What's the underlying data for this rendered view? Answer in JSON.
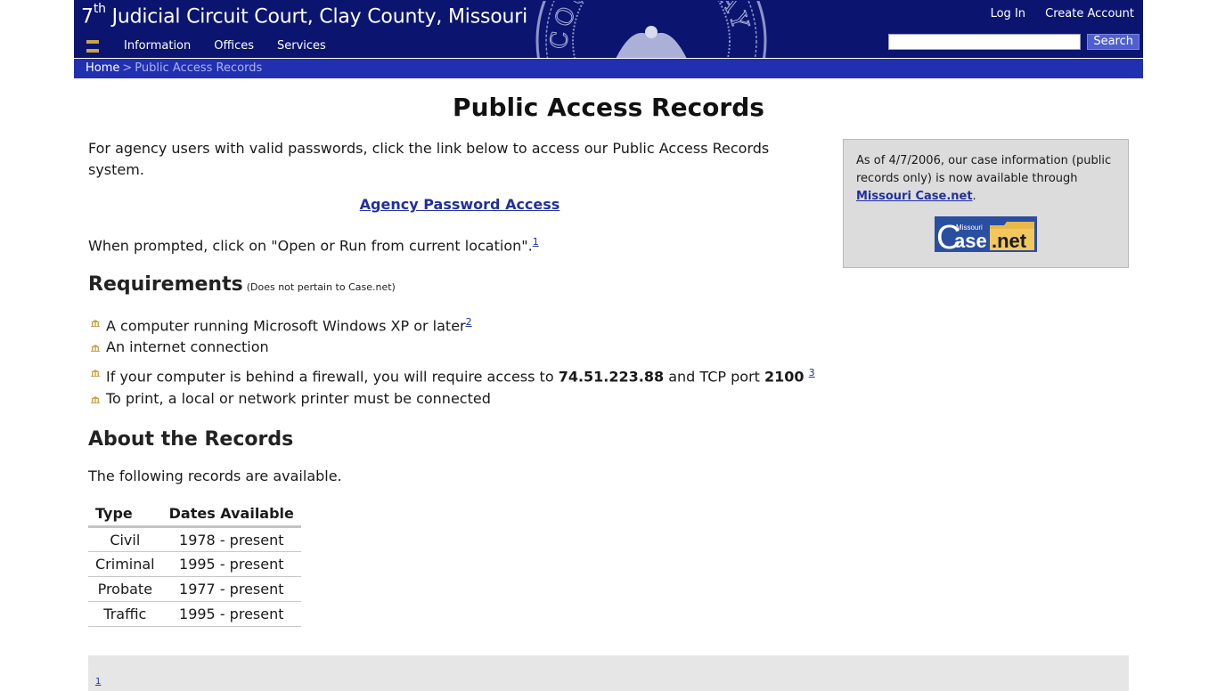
{
  "header": {
    "title_sup": "th",
    "title_prefix": "7",
    "title_rest": " Judicial Circuit Court,  Clay County, Missouri",
    "nav": [
      {
        "label": "Information"
      },
      {
        "label": "Offices"
      },
      {
        "label": "Services"
      }
    ],
    "account": {
      "login_label": "Log In",
      "create_label": "Create Account"
    },
    "search": {
      "value": "",
      "placeholder": "",
      "button_label": "Search"
    },
    "seal_text": "COURT OF CLAY"
  },
  "breadcrumb": {
    "home": "Home",
    "separator": ">",
    "current": "Public Access Records"
  },
  "page_title": "Public Access Records",
  "intro": {
    "text": "For agency users with valid passwords, click the link below to access our Public Access Records system.",
    "agency_link": "Agency Password Access",
    "prompted_text": "When prompted, click on \"Open or Run from current location\".",
    "prompted_footnote": "1"
  },
  "requirements": {
    "heading": "Requirements",
    "note": "(Does not pertain to Case.net)",
    "items": [
      {
        "text": "A computer running Microsoft Windows XP or later",
        "footnote": "2"
      },
      {
        "text": "An internet connection"
      },
      {
        "text_before": "If your computer is behind a firewall, you will require access to ",
        "ip": "74.51.223.88",
        "text_mid": " and TCP port ",
        "port": "2100",
        "footnote": "3"
      },
      {
        "text": "To print, a local or network printer must be connected"
      }
    ]
  },
  "about": {
    "heading": "About the Records",
    "text": "The following records are available.",
    "table": {
      "headers": [
        "Type",
        "Dates Available"
      ],
      "rows": [
        [
          "Civil",
          "1978 - present"
        ],
        [
          "Criminal",
          "1995 - present"
        ],
        [
          "Probate",
          "1977 - present"
        ],
        [
          "Traffic",
          "1995 - present"
        ]
      ]
    }
  },
  "sidebar": {
    "text_before": "As of 4/7/2006, our case information (public records only) is now available through ",
    "link": "Missouri Case.net",
    "text_after": ".",
    "logo": {
      "small": "Missouri",
      "big_c": "C",
      "big_ase": "ase",
      "net": ".net"
    }
  },
  "footnotes": {
    "first_marker": "1"
  },
  "colors": {
    "header_bg": "#0b1570",
    "breadcrumb_bg": "#2030b0",
    "link": "#22309e",
    "accent_gold": "#c9a54a",
    "sidebar_bg": "#dcdcdc"
  }
}
